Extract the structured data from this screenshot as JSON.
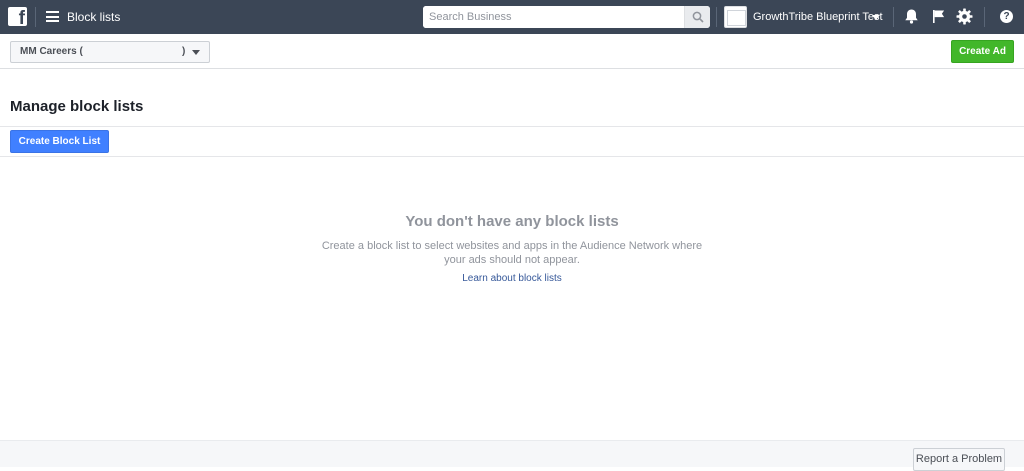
{
  "topbar": {
    "logo_letter": "f",
    "title": "Block lists",
    "search_placeholder": "Search Business",
    "business_name": "GrowthTribe Blueprint Test",
    "help_glyph": "?",
    "icons": [
      "facebook-logo-icon",
      "menu-icon",
      "search-icon",
      "business-avatar-icon",
      "chevron-down-icon",
      "notifications-bell-icon",
      "flag-icon",
      "gear-icon",
      "help-icon"
    ]
  },
  "subbar": {
    "account_label": "MM Careers (",
    "account_suffix": ")",
    "create_ad": "Create Ad"
  },
  "main": {
    "title": "Manage block lists",
    "create_button": "Create Block List",
    "empty_title": "You don't have any block lists",
    "empty_description": "Create a block list to select websites and apps in the Audience Network where your ads should not appear.",
    "learn_link": "Learn about block lists"
  },
  "footer": {
    "report_button": "Report a Problem"
  },
  "colors": {
    "topbar": "#3b4656",
    "primary_blue": "#4080ff",
    "green": "#42b72a",
    "link": "#365899",
    "muted_text": "#90949c"
  }
}
